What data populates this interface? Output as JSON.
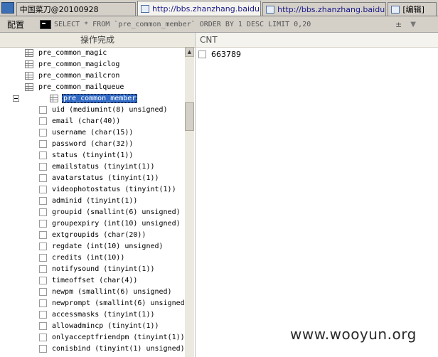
{
  "tabs": [
    {
      "label": "中国菜刀@20100928",
      "kind": "app"
    },
    {
      "label": "http://bbs.zhanzhang.baidu.c...",
      "kind": "url",
      "active": true
    },
    {
      "label": "http://bbs.zhanzhang.baidu.c...",
      "kind": "url"
    },
    {
      "label": "[编辑]",
      "kind": "other"
    }
  ],
  "querybar": {
    "config_label": "配置",
    "sql": "SELECT * FROM `pre_common_member` ORDER BY 1 DESC LIMIT 0,20",
    "pm_label": "±",
    "dropdown_label": "▼"
  },
  "left_panel": {
    "status": "操作完成",
    "tables_before": [
      "pre_common_magic",
      "pre_common_magiclog",
      "pre_common_mailcron",
      "pre_common_mailqueue"
    ],
    "selected_table": "pre_common_member",
    "columns": [
      "uid (mediumint(8) unsigned)",
      "email (char(40))",
      "username (char(15))",
      "password (char(32))",
      "status (tinyint(1))",
      "emailstatus (tinyint(1))",
      "avatarstatus (tinyint(1))",
      "videophotostatus (tinyint(1))",
      "adminid (tinyint(1))",
      "groupid (smallint(6) unsigned)",
      "groupexpiry (int(10) unsigned)",
      "extgroupids (char(20))",
      "regdate (int(10) unsigned)",
      "credits (int(10))",
      "notifysound (tinyint(1))",
      "timeoffset (char(4))",
      "newpm (smallint(6) unsigned)",
      "newprompt (smallint(6) unsigned)",
      "accessmasks (tinyint(1))",
      "allowadmincp (tinyint(1))",
      "onlyacceptfriendpm (tinyint(1))",
      "conisbind (tinyint(1) unsigned)"
    ]
  },
  "result": {
    "header": "CNT",
    "rows": [
      "663789"
    ]
  },
  "watermark": "www.wooyun.org"
}
